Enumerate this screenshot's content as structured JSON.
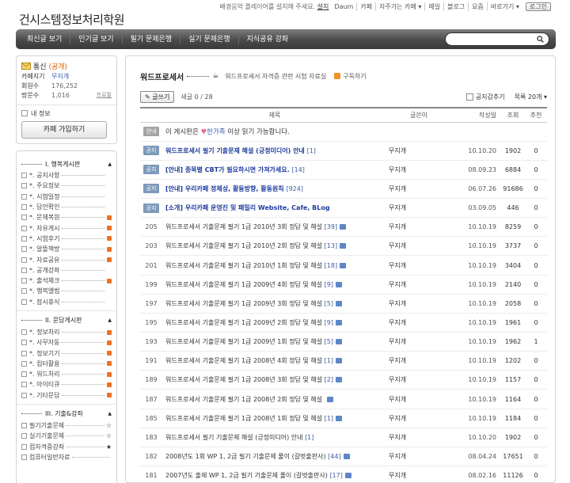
{
  "topbar": {
    "notice_text": "배경음악 플레이어를 설치해 주세요.",
    "notice_link": "설치",
    "links": [
      "Daum",
      "카페",
      "자주가는 카페 ▾",
      "메일",
      "블로그",
      "요즘",
      "바로가기 ▾"
    ],
    "login": "로그인"
  },
  "cafe_title": "건시스템정보처리학원",
  "menu": {
    "items": [
      "최신글 보기",
      "인기글 보기",
      "필기 문제은행",
      "실기 문제은행",
      "지식공유 강좌"
    ],
    "search_placeholder": ""
  },
  "sidebar": {
    "info": {
      "title_prefix": "통신",
      "title_status": "(공개)",
      "rows": [
        {
          "k": "카페지기",
          "v": "무지개"
        },
        {
          "k": "회원수",
          "v": "176,252"
        },
        {
          "k": "방문수",
          "v": "1,016",
          "extra": "프로필"
        }
      ],
      "my_info": "내 정보",
      "join": "카페 가입하기"
    },
    "groups": [
      {
        "title": "I. 행복게시판",
        "items": [
          {
            "label": "*. 공지사항",
            "new": false
          },
          {
            "label": "*. 주요정보",
            "new": false
          },
          {
            "label": "*. 시험일정",
            "new": false
          },
          {
            "label": "*. 답안확인",
            "new": false
          },
          {
            "label": "*. 문제복원",
            "new": true
          },
          {
            "label": "*. 자유게시",
            "new": true
          },
          {
            "label": "*. 시험후기",
            "new": true
          },
          {
            "label": "*. 알뜰책방",
            "new": true
          },
          {
            "label": "*. 자료공유",
            "new": true
          },
          {
            "label": "*. 공개강좌",
            "new": false
          },
          {
            "label": "*. 출석체크",
            "new": true
          },
          {
            "label": "*. 행복앨범",
            "new": false
          },
          {
            "label": "*. 잠시휴식",
            "new": false
          }
        ]
      },
      {
        "title": "II. 문답게시판",
        "items": [
          {
            "label": "*. 정보처리",
            "new": true
          },
          {
            "label": "*. 사무자동",
            "new": true
          },
          {
            "label": "*. 정보기기",
            "new": true
          },
          {
            "label": "*. 컴터활용",
            "new": true
          },
          {
            "label": "*. 워드처리",
            "new": true
          },
          {
            "label": "*. 아이티큐",
            "new": true
          },
          {
            "label": "*. 기타문답",
            "new": true
          }
        ]
      },
      {
        "title": "III. 기출&강좌",
        "items": [
          {
            "label": "필기기출문제",
            "star": "☆"
          },
          {
            "label": "실기기출문제",
            "star": "☆"
          },
          {
            "label": "컴자격증강좌",
            "star": "★"
          },
          {
            "label": "컴퓨터일반자료",
            "star": ""
          }
        ]
      }
    ]
  },
  "board": {
    "name": "워드프로세서",
    "description": "워드프로세서 자격증 관련 시험 자료실",
    "rss": "구독하기",
    "write": "글쓰기",
    "count_label": "새글",
    "count_new": "0",
    "count_total": "/ 28",
    "notice_hide": "공지감추기",
    "list_size": "목록 20개 ▾",
    "columns": [
      "제목",
      "글쓴이",
      "작성일",
      "조회",
      "추천"
    ],
    "info_badge": "안내",
    "info_pre": "이 게시판은",
    "info_mark": "한가족",
    "info_post": "이상 읽기 가능합니다.",
    "notice_badge": "공지",
    "rows": [
      {
        "num": "공지",
        "title": "워드프로세서 필기 기출문제 해설 (긍정미디어) 안내",
        "cmt": "[1]",
        "author": "무지개",
        "date": "10.10.20",
        "views": "1902",
        "rec": "0",
        "pin": true
      },
      {
        "num": "공지",
        "title": "[안내] 종목별 CBT가 필요하시면 가져가세요.",
        "cmt": "[14]",
        "author": "무지개",
        "date": "08.09.23",
        "views": "6884",
        "rec": "0",
        "pin": true
      },
      {
        "num": "공지",
        "title": "[안내] 우리카페 정체성, 활동방향, 활동원칙",
        "cmt": "[924]",
        "author": "무지개",
        "date": "06.07.26",
        "views": "91686",
        "rec": "0",
        "pin": true
      },
      {
        "num": "공지",
        "title": "[소개] 우리카페 운영진 및 패밀리 Website, Cafe, BLog",
        "cmt": "",
        "author": "무지개",
        "date": "03.09.05",
        "views": "446",
        "rec": "0",
        "pin": true
      },
      {
        "num": "205",
        "title": "워드프로세서 기출문제 필기 1급 2010년 3회 정답 및 해설",
        "cmt": "[39]",
        "att": true,
        "author": "무지개",
        "date": "10.10.19",
        "views": "8259",
        "rec": "0"
      },
      {
        "num": "203",
        "title": "워드프로세서 기출문제 필기 1급 2010년 2회 정답 및 해설",
        "cmt": "[13]",
        "att": true,
        "author": "무지개",
        "date": "10.10.19",
        "views": "3737",
        "rec": "0"
      },
      {
        "num": "201",
        "title": "워드프로세서 기출문제 필기 1급 2010년 1회 정답 및 해설",
        "cmt": "[18]",
        "att": true,
        "author": "무지개",
        "date": "10.10.19",
        "views": "3404",
        "rec": "0"
      },
      {
        "num": "199",
        "title": "워드프로세서 기출문제 필기 1급 2009년 4회 정답 및 해설",
        "cmt": "[9]",
        "att": true,
        "author": "무지개",
        "date": "10.10.19",
        "views": "2140",
        "rec": "0"
      },
      {
        "num": "197",
        "title": "워드프로세서 기출문제 필기 1급 2009년 3회 정답 및 해설",
        "cmt": "[5]",
        "att": true,
        "author": "무지개",
        "date": "10.10.19",
        "views": "2058",
        "rec": "0"
      },
      {
        "num": "195",
        "title": "워드프로세서 기출문제 필기 1급 2009년 2회 정답 및 해설",
        "cmt": "[9]",
        "att": true,
        "author": "무지개",
        "date": "10.10.19",
        "views": "1961",
        "rec": "0"
      },
      {
        "num": "193",
        "title": "워드프로세서 기출문제 필기 1급 2009년 1회 정답 및 해설",
        "cmt": "[5]",
        "att": true,
        "author": "무지개",
        "date": "10.10.19",
        "views": "1962",
        "rec": "1"
      },
      {
        "num": "191",
        "title": "워드프로세서 기출문제 필기 1급 2008년 4회 정답 및 해설",
        "cmt": "[1]",
        "att": true,
        "author": "무지개",
        "date": "10.10.19",
        "views": "1202",
        "rec": "0"
      },
      {
        "num": "189",
        "title": "워드프로세서 기출문제 필기 1급 2008년 3회 정답 및 해설",
        "cmt": "[2]",
        "att": true,
        "author": "무지개",
        "date": "10.10.19",
        "views": "1157",
        "rec": "0"
      },
      {
        "num": "187",
        "title": "워드프로세서 기출문제 필기 1급 2008년 2회 정답 및 해설",
        "cmt": "",
        "att": true,
        "author": "무지개",
        "date": "10.10.19",
        "views": "1164",
        "rec": "0"
      },
      {
        "num": "185",
        "title": "워드프로세서 기출문제 필기 1급 2008년 1회 정답 및 해설",
        "cmt": "[1]",
        "att": true,
        "author": "무지개",
        "date": "10.10.19",
        "views": "1184",
        "rec": "0"
      },
      {
        "num": "183",
        "title": "워드프로세서 필기 기출문제 해설 (긍정미디어) 안내",
        "cmt": "[1]",
        "author": "무지개",
        "date": "10.10.20",
        "views": "1902",
        "rec": "0"
      },
      {
        "num": "182",
        "title": "2008년도 1회 WP 1, 2급 필기 기출문제 풀이 (갈벗출판사)",
        "cmt": "[44]",
        "att": true,
        "author": "무지개",
        "date": "08.04.24",
        "views": "17651",
        "rec": "0"
      },
      {
        "num": "181",
        "title": "2007년도 출제 WP 1, 2급 필기 기출문제 풀이 (갈벗출판사)",
        "cmt": "[17]",
        "att": true,
        "author": "무지개",
        "date": "08.02.16",
        "views": "11126",
        "rec": "0"
      }
    ]
  }
}
